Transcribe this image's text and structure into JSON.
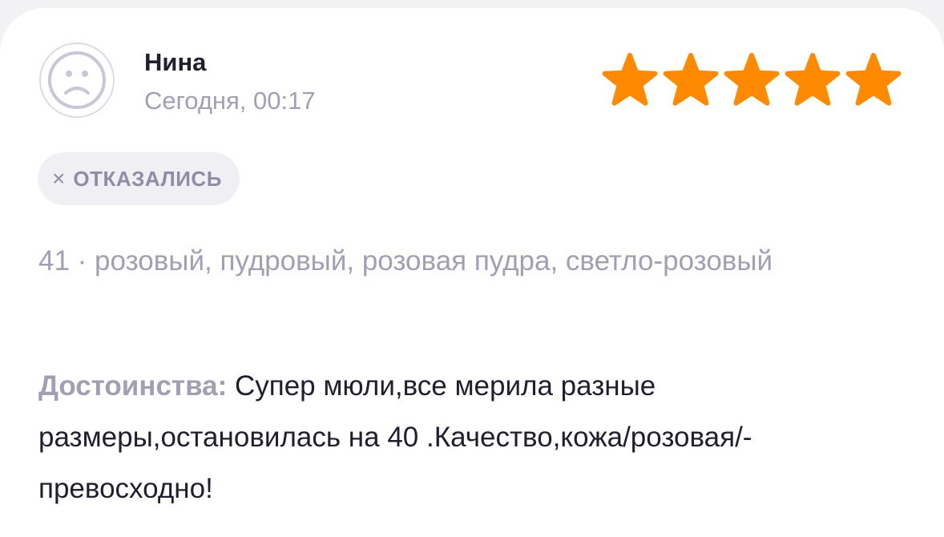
{
  "review": {
    "author_name": "Нина",
    "date": "Сегодня, 00:17",
    "avatar_icon": "sad-face-icon",
    "rating": 5,
    "rating_max": 5,
    "star_color": "#ff8a00",
    "star_icon": "star-icon",
    "status_badge": {
      "icon": "close-icon",
      "icon_glyph": "×",
      "label": "ОТКАЗАЛИСЬ"
    },
    "variant": "41 · розовый, пудровый, розовая пудра, светло-розовый",
    "pros_label": "Достоинства:",
    "pros_text": "Супер мюли,все мерила разные размеры,остановилась на 40 .Качество,кожа/розовая/-превосходно!"
  }
}
